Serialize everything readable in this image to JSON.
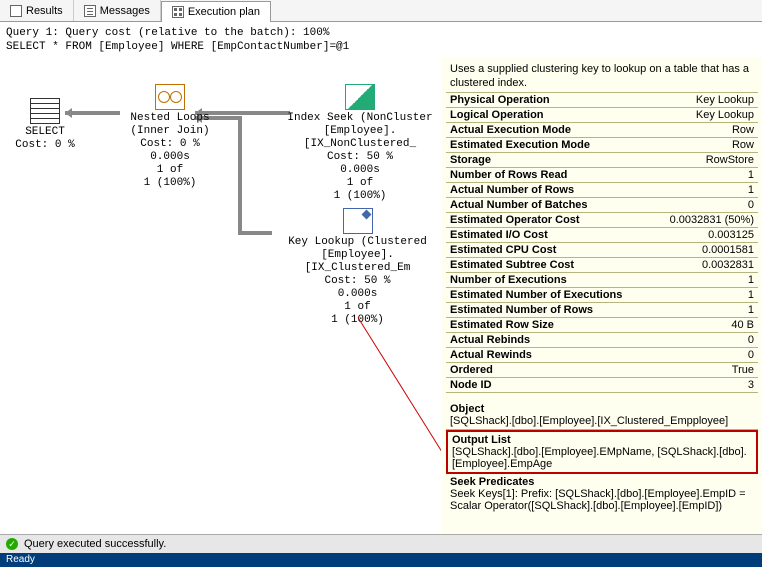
{
  "tabs": {
    "results": "Results",
    "messages": "Messages",
    "execplan": "Execution plan"
  },
  "query": {
    "line1": "Query 1: Query cost (relative to the batch): 100%",
    "line2": "SELECT * FROM [Employee] WHERE [EmpContactNumber]=@1"
  },
  "nodes": {
    "select": {
      "label1": "SELECT",
      "cost": "Cost: 0 %"
    },
    "nested": {
      "label1": "Nested Loops",
      "label2": "(Inner Join)",
      "cost": "Cost: 0 %",
      "time": "0.000s",
      "rows1": "1 of",
      "rows2": "1 (100%)"
    },
    "seek": {
      "label1": "Index Seek (NonCluster",
      "label2": "[Employee].[IX_NonClustered_",
      "cost": "Cost: 50 %",
      "time": "0.000s",
      "rows1": "1 of",
      "rows2": "1 (100%)"
    },
    "lookup": {
      "label1": "Key Lookup (Clustered",
      "label2": "[Employee].[IX_Clustered_Em",
      "cost": "Cost: 50 %",
      "time": "0.000s",
      "rows1": "1 of",
      "rows2": "1 (100%)"
    }
  },
  "details": {
    "description": "Uses a supplied clustering key to lookup on a table that has a clustered index.",
    "rows": [
      {
        "k": "Physical Operation",
        "v": "Key Lookup"
      },
      {
        "k": "Logical Operation",
        "v": "Key Lookup"
      },
      {
        "k": "Actual Execution Mode",
        "v": "Row"
      },
      {
        "k": "Estimated Execution Mode",
        "v": "Row"
      },
      {
        "k": "Storage",
        "v": "RowStore"
      },
      {
        "k": "Number of Rows Read",
        "v": "1"
      },
      {
        "k": "Actual Number of Rows",
        "v": "1"
      },
      {
        "k": "Actual Number of Batches",
        "v": "0"
      },
      {
        "k": "Estimated Operator Cost",
        "v": "0.0032831 (50%)"
      },
      {
        "k": "Estimated I/O Cost",
        "v": "0.003125"
      },
      {
        "k": "Estimated CPU Cost",
        "v": "0.0001581"
      },
      {
        "k": "Estimated Subtree Cost",
        "v": "0.0032831"
      },
      {
        "k": "Number of Executions",
        "v": "1"
      },
      {
        "k": "Estimated Number of Executions",
        "v": "1"
      },
      {
        "k": "Estimated Number of Rows",
        "v": "1"
      },
      {
        "k": "Estimated Row Size",
        "v": "40 B"
      },
      {
        "k": "Actual Rebinds",
        "v": "0"
      },
      {
        "k": "Actual Rewinds",
        "v": "0"
      },
      {
        "k": "Ordered",
        "v": "True"
      },
      {
        "k": "Node ID",
        "v": "3"
      }
    ],
    "object": {
      "title": "Object",
      "text": "[SQLShack].[dbo].[Employee].[IX_Clustered_Empployee]"
    },
    "output": {
      "title": "Output List",
      "text": "[SQLShack].[dbo].[Employee].EMpName, [SQLShack].[dbo].[Employee].EmpAge"
    },
    "seek": {
      "title": "Seek Predicates",
      "text": "Seek Keys[1]: Prefix: [SQLShack].[dbo].[Employee].EmpID = Scalar Operator([SQLShack].[dbo].[Employee].[EmpID])"
    }
  },
  "status": {
    "success": "Query executed successfully.",
    "ready": "Ready"
  }
}
